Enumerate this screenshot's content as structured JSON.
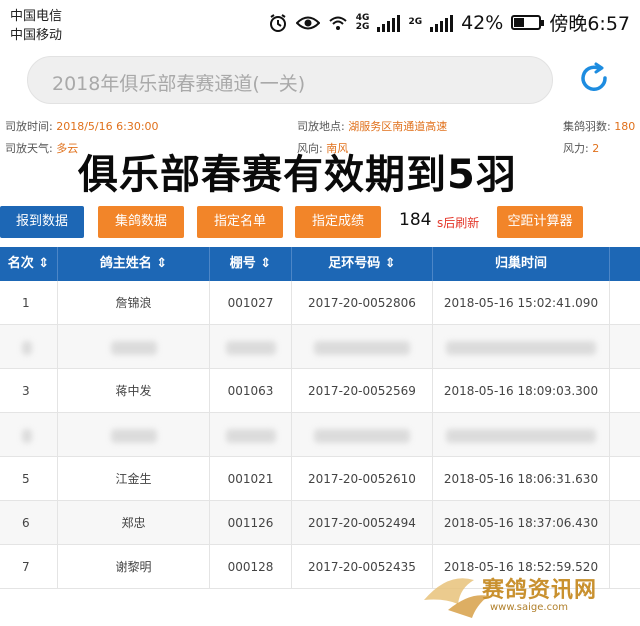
{
  "status_bar": {
    "carrier1": "中国电信",
    "carrier2": "中国移动",
    "battery": "42%",
    "time": "傍晚6:57",
    "battery_level": 0.42,
    "signal_tag1": "4G",
    "signal_tag1b": "2G",
    "signal_tag2": "2G"
  },
  "header": {
    "title": "2018年俱乐部春赛通道(一关)"
  },
  "info": {
    "release_time_label": "司放时间:",
    "release_time": "2018/5/16 6:30:00",
    "release_place_label": "司放地点:",
    "release_place": "湖服务区南通道高速",
    "pigeon_count_label": "集鸽羽数:",
    "pigeon_count": "180",
    "weather_label": "司放天气:",
    "weather": "多云",
    "wind_dir_label": "风向:",
    "wind_dir": "南风",
    "wind_power_label": "风力:",
    "wind_power": "2"
  },
  "overlay_text": "俱乐部春赛有效期到5羽",
  "toolbar": {
    "report_btn": "报到数据",
    "collect_btn": "集鸽数据",
    "list_btn": "指定名单",
    "score_btn": "指定成绩",
    "countdown": "184",
    "countdown_suffix": "s后刷新",
    "calc_btn": "空距计算器"
  },
  "table": {
    "headers": [
      "名次 ⇕",
      "鸽主姓名 ⇕",
      "棚号 ⇕",
      "足环号码 ⇕",
      "归巢时间"
    ],
    "rows": [
      {
        "rank": "1",
        "name": "詹锦浪",
        "loft": "001027",
        "ring": "2017-20-0052806",
        "time": "2018-05-16 15:02:41.090",
        "blurred": false
      },
      {
        "rank": "",
        "name": "",
        "loft": "",
        "ring": "",
        "time": "",
        "blurred": true
      },
      {
        "rank": "3",
        "name": "蒋中发",
        "loft": "001063",
        "ring": "2017-20-0052569",
        "time": "2018-05-16 18:09:03.300",
        "blurred": false
      },
      {
        "rank": "",
        "name": "",
        "loft": "",
        "ring": "",
        "time": "",
        "blurred": true
      },
      {
        "rank": "5",
        "name": "江金生",
        "loft": "001021",
        "ring": "2017-20-0052610",
        "time": "2018-05-16 18:06:31.630",
        "blurred": false
      },
      {
        "rank": "6",
        "name": "郑忠",
        "loft": "001126",
        "ring": "2017-20-0052494",
        "time": "2018-05-16 18:37:06.430",
        "blurred": false
      },
      {
        "rank": "7",
        "name": "谢黎明",
        "loft": "000128",
        "ring": "2017-20-0052435",
        "time": "2018-05-16 18:52:59.520",
        "blurred": false
      }
    ]
  },
  "watermark": {
    "name": "赛鸽资讯网",
    "url": "www.saige.com"
  }
}
